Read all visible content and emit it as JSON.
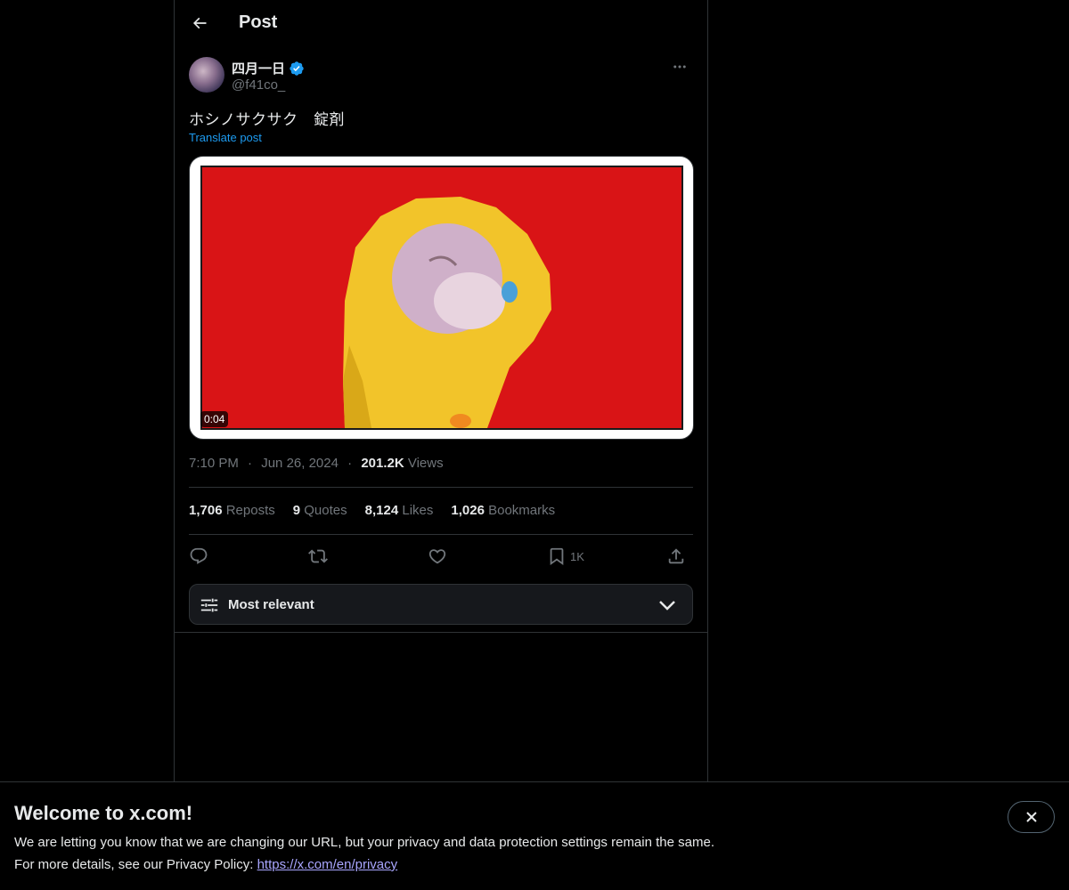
{
  "header": {
    "title": "Post"
  },
  "author": {
    "name": "四月一日",
    "handle": "@f41co_"
  },
  "post": {
    "text": "ホシノサクサク　錠剤",
    "translate_label": "Translate post",
    "video_duration": "0:04",
    "time": "7:10 PM",
    "date": "Jun 26, 2024",
    "separator": "·",
    "views_count": "201.2K",
    "views_label": "Views"
  },
  "stats": [
    {
      "count": "1,706",
      "label": "Reposts"
    },
    {
      "count": "9",
      "label": "Quotes"
    },
    {
      "count": "8,124",
      "label": "Likes"
    },
    {
      "count": "1,026",
      "label": "Bookmarks"
    }
  ],
  "actions": {
    "bookmark_count": "1K"
  },
  "sort": {
    "label": "Most relevant"
  },
  "banner": {
    "title": "Welcome to x.com!",
    "line1": "We are letting you know that we are changing our URL, but your privacy and data protection settings remain the same.",
    "line2_prefix": "For more details, see our Privacy Policy: ",
    "link": "https://x.com/en/privacy"
  },
  "colors": {
    "accent": "#1d9bf0",
    "muted": "#71767b",
    "text": "#e7e9ea",
    "border": "#2f3336",
    "media_bg": "#d91416"
  },
  "icons": [
    "back-arrow-icon",
    "verified-badge-icon",
    "more-icon",
    "reply-icon",
    "repost-icon",
    "like-icon",
    "bookmark-icon",
    "share-icon",
    "sort-sliders-icon",
    "chevron-down-icon",
    "close-icon"
  ]
}
